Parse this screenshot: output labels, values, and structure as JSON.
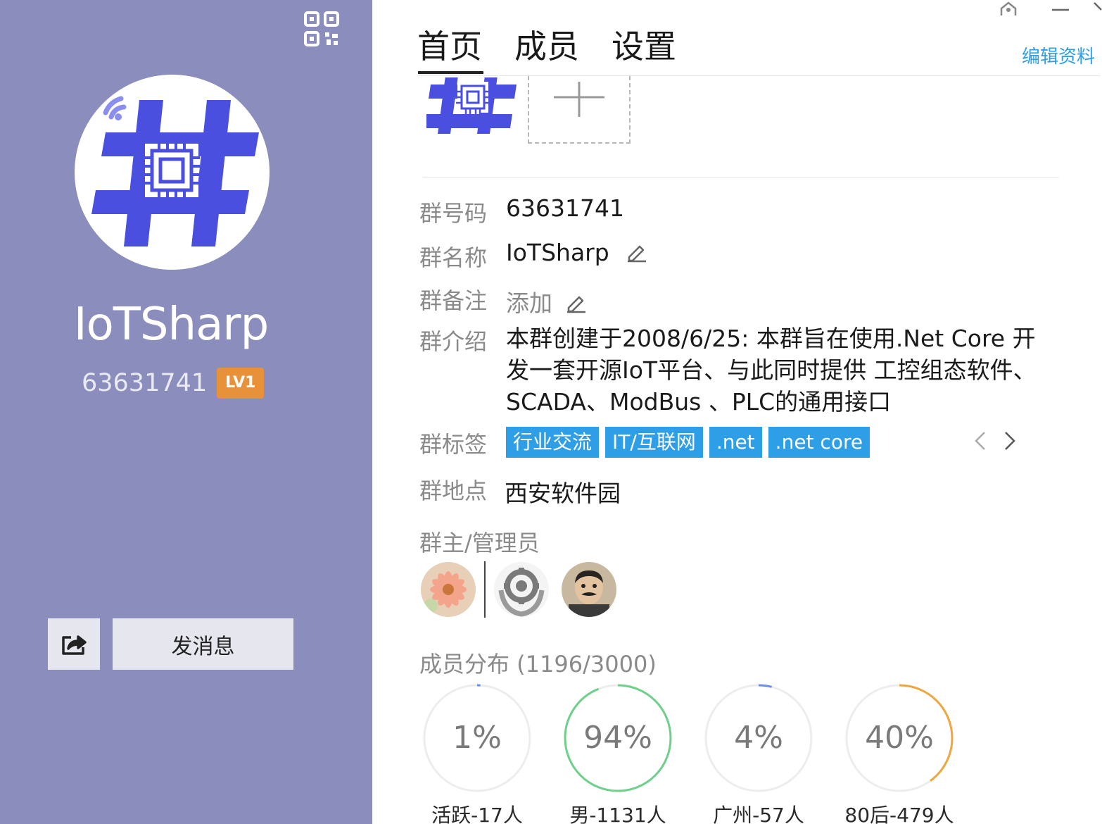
{
  "profile": {
    "name": "IoTSharp",
    "group_id": "63631741",
    "level": "LV1",
    "send_message_label": "发消息"
  },
  "tabs": [
    {
      "label": "首页",
      "active": true
    },
    {
      "label": "成员",
      "active": false
    },
    {
      "label": "设置",
      "active": false
    }
  ],
  "edit_profile_label": "编辑资料",
  "info": {
    "group_id_label": "群号码",
    "group_id_value": "63631741",
    "name_label": "群名称",
    "name_value": "IoTSharp",
    "remark_label": "群备注",
    "remark_value": "添加",
    "intro_label": "群介绍",
    "intro_value": "本群创建于2008/6/25: 本群旨在使用.Net Core 开发一套开源IoT平台、与此同时提供 工控组态软件、SCADA、ModBus 、PLC的通用接口",
    "tags_label": "群标签",
    "tags": [
      "行业交流",
      "IT/互联网",
      ".net",
      ".net core"
    ],
    "location_label": "群地点",
    "location_value": "西安软件园",
    "admins_label": "群主/管理员"
  },
  "distribution": {
    "title": "成员分布 (1196/3000)",
    "stats": [
      {
        "percent_label": "1%",
        "value": 1,
        "color": "#6b8fe8",
        "label": "活跃-17人"
      },
      {
        "percent_label": "94%",
        "value": 94,
        "color": "#6fd08c",
        "label": "男-1131人"
      },
      {
        "percent_label": "4%",
        "value": 4,
        "color": "#6b8fe8",
        "label": "广州-57人"
      },
      {
        "percent_label": "40%",
        "value": 40,
        "color": "#f0a640",
        "label": "80后-479人"
      }
    ]
  },
  "colors": {
    "sidebar_bg": "#8b8dbc",
    "accent_blue": "#2e9ee6",
    "level_badge": "#e8913b",
    "logo_blue": "#4a4fe0"
  }
}
